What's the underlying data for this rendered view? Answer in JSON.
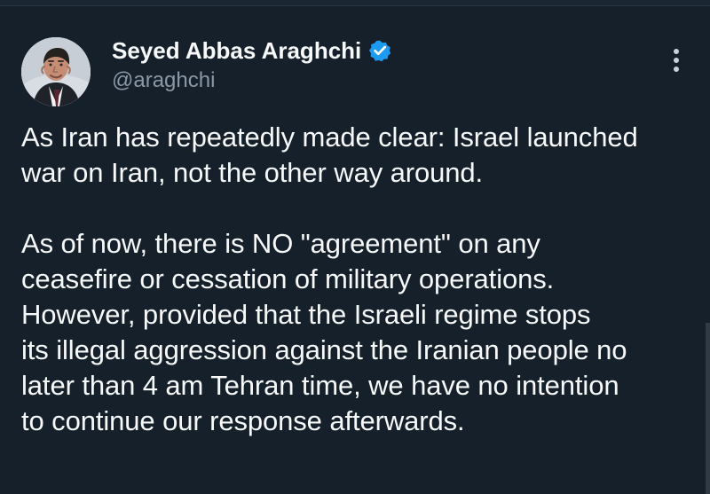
{
  "tweet": {
    "author": {
      "name": "Seyed Abbas Araghchi",
      "handle": "@araghchi",
      "avatar": "portrait-avatar",
      "verified_icon": "verified-badge-icon",
      "verified_color": "#1d9bf0"
    },
    "more_icon": "vertical-ellipsis-icon",
    "body": {
      "lines": [
        "As Iran has repeatedly made clear: Israel launched",
        "war on Iran, not the other way around.",
        "As of now, there is NO \"agreement\" on any",
        "ceasefire or cessation of military operations.",
        "However, provided that the Israeli regime stops",
        "its illegal aggression against the Iranian people no",
        "later than 4 am Tehran time, we have no intention",
        "to continue our response afterwards."
      ]
    }
  },
  "theme": {
    "background": "#15202b",
    "text": "#f7f9f9",
    "secondary_text": "#8b98a5"
  }
}
